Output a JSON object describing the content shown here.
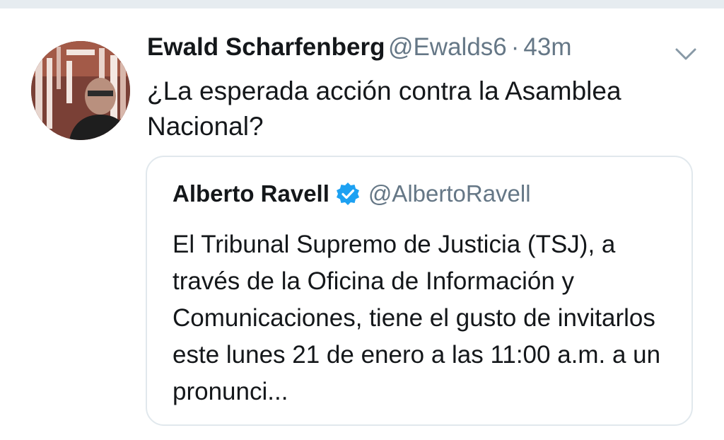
{
  "tweet": {
    "author_name": "Ewald Scharfenberg",
    "author_handle": "@Ewalds6",
    "separator": "·",
    "time": "43m",
    "text": "¿La esperada acción contra la Asamblea Nacional?",
    "menu_icon": "chevron-down-icon"
  },
  "quoted_tweet": {
    "author_name": "Alberto Ravell",
    "verified_icon": "verified-badge-icon",
    "author_handle": "@AlbertoRavell",
    "text": "El Tribunal Supremo de Justicia (TSJ), a través de la Oficina de Información y Comunicaciones, tiene el gusto de invitarlos este lunes 21 de enero a las 11:00 a.m. a un pronunci..."
  },
  "colors": {
    "text": "#14171a",
    "secondary": "#657786",
    "verified": "#1da1f2",
    "border": "#e1e8ed"
  }
}
